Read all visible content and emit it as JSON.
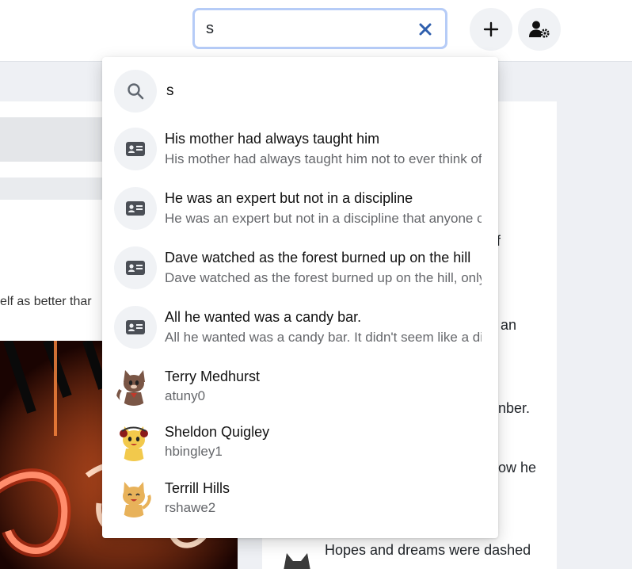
{
  "header": {
    "search_value": "s",
    "add_label": "+",
    "icons": {
      "clear": "close-icon",
      "add": "plus-icon",
      "user_settings": "user-gear-icon"
    }
  },
  "dropdown": {
    "query": "s",
    "query_icon": "search-icon",
    "posts": [
      {
        "title": "His mother had always taught him",
        "snippet": "His mother had always taught him not to ever think of himself as better than others."
      },
      {
        "title": "He was an expert but not in a discipline",
        "snippet": "He was an expert but not in a discipline that anyone could fully appreciate."
      },
      {
        "title": "Dave watched as the forest burned up on the hill",
        "snippet": "Dave watched as the forest burned up on the hill, only a few miles from his house."
      },
      {
        "title": "All he wanted was a candy bar.",
        "snippet": "All he wanted was a candy bar. It didn't seem like a difficult request to comprehend."
      }
    ],
    "post_icon": "id-card-icon",
    "users": [
      {
        "name": "Terry Medhurst",
        "username": "atuny0"
      },
      {
        "name": "Sheldon Quigley",
        "username": "hbingley1"
      },
      {
        "name": "Terrill Hills",
        "username": "rshawe2"
      }
    ]
  },
  "background": {
    "left_text": "elf as better thar",
    "right_fragments": [
      "f",
      "an",
      "nber.",
      "ow he"
    ],
    "bottom_text": "Hopes and dreams were dashed"
  },
  "colors": {
    "accent": "#b6ccf7",
    "clear_x": "#2f5fad",
    "circle_bg": "#f0f2f5",
    "muted_text": "#65676b"
  }
}
